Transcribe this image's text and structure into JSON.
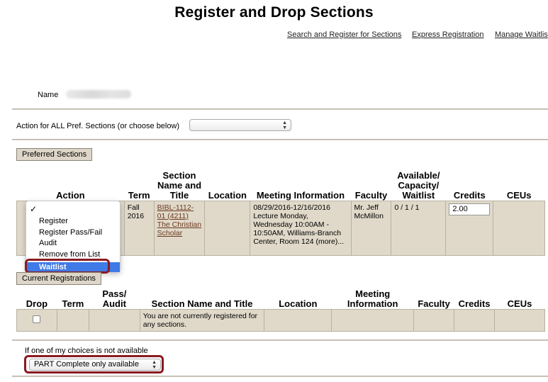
{
  "page": {
    "title": "Register and Drop Sections"
  },
  "top_links": [
    {
      "label": "Search and Register for Sections"
    },
    {
      "label": "Express Registration"
    },
    {
      "label": "Manage Waitlis"
    }
  ],
  "name_row": {
    "label": "Name"
  },
  "action_all": {
    "label": "Action for ALL Pref. Sections (or choose below)",
    "value": ""
  },
  "preferred": {
    "button_label": "Preferred Sections",
    "headers": {
      "action": "Action",
      "term": "Term",
      "section": "Section Name and Title",
      "location": "Location",
      "meeting": "Meeting Information",
      "faculty": "Faculty",
      "available": "Available/ Capacity/ Waitlist",
      "credits": "Credits",
      "ceus": "CEUs"
    },
    "row": {
      "term": "Fall 2016",
      "section_link": "BIBL-1112-01 (4211) The Christian Scholar",
      "location": "",
      "meeting": "08/29/2016-12/16/2016 Lecture Monday, Wednesday 10:00AM - 10:50AM, Williams-Branch Center, Room 124 (more)...",
      "faculty": "Mr. Jeff McMillon",
      "available": "0 / 1 / 1",
      "credits_value": "2.00",
      "ceus": ""
    },
    "action_dropdown": {
      "check": "✓",
      "options": [
        "Register",
        "Register Pass/Fail",
        "Audit",
        "Remove from List"
      ],
      "selected": "Waitlist"
    }
  },
  "current": {
    "button_label": "Current Registrations",
    "headers": {
      "drop": "Drop",
      "term": "Term",
      "passaudit": "Pass/ Audit",
      "section": "Section Name and Title",
      "location": "Location",
      "meeting": "Meeting Information",
      "faculty": "Faculty",
      "credits": "Credits",
      "ceus": "CEUs"
    },
    "empty_message": "You are not currently registered for any sections."
  },
  "fallback": {
    "label": "If one of my choices is not available",
    "value": "PART Complete only available"
  },
  "colors": {
    "row_bg": "#e0d9ca",
    "highlight": "#8a1a22",
    "selection": "#3f7ae6",
    "link": "#6b3a1f"
  }
}
